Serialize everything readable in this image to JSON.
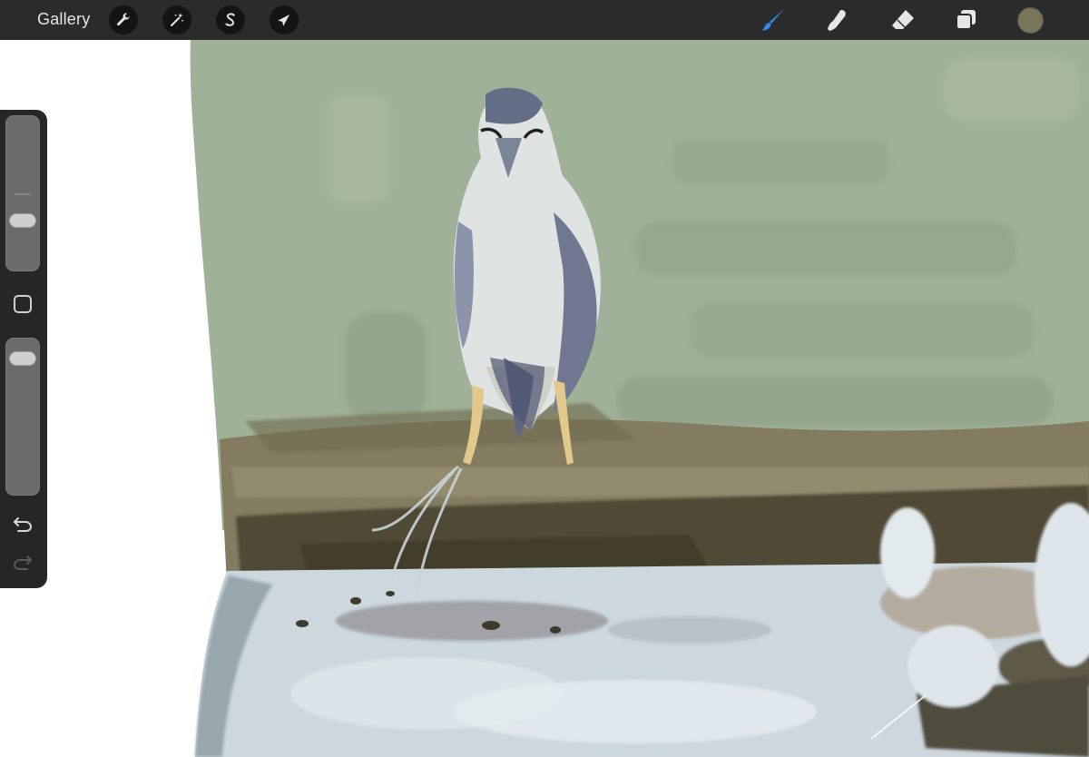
{
  "app": {
    "gallery_label": "Gallery"
  },
  "toolbar": {
    "left_tools": [
      {
        "name": "actions",
        "icon": "wrench-icon"
      },
      {
        "name": "adjustments",
        "icon": "magic-wand-icon"
      },
      {
        "name": "selection",
        "icon": "selection-s-icon"
      },
      {
        "name": "transform",
        "icon": "arrow-cursor-icon"
      }
    ],
    "right_tools": [
      {
        "name": "brush",
        "icon": "brush-icon",
        "active": true
      },
      {
        "name": "smudge",
        "icon": "smudge-finger-icon",
        "active": false
      },
      {
        "name": "eraser",
        "icon": "eraser-icon",
        "active": false
      },
      {
        "name": "layers",
        "icon": "layers-icon",
        "active": false
      }
    ],
    "current_color": "#7a7559"
  },
  "sidebar": {
    "brush_size_level": 0.3,
    "opacity_level": 0.93
  },
  "colors": {
    "toolbar_bg": "#2b2b2b",
    "active_tool": "#2f8bf0",
    "sky": "#9fb198",
    "ground": "#6f6a4e",
    "water": "#ccd7de"
  }
}
